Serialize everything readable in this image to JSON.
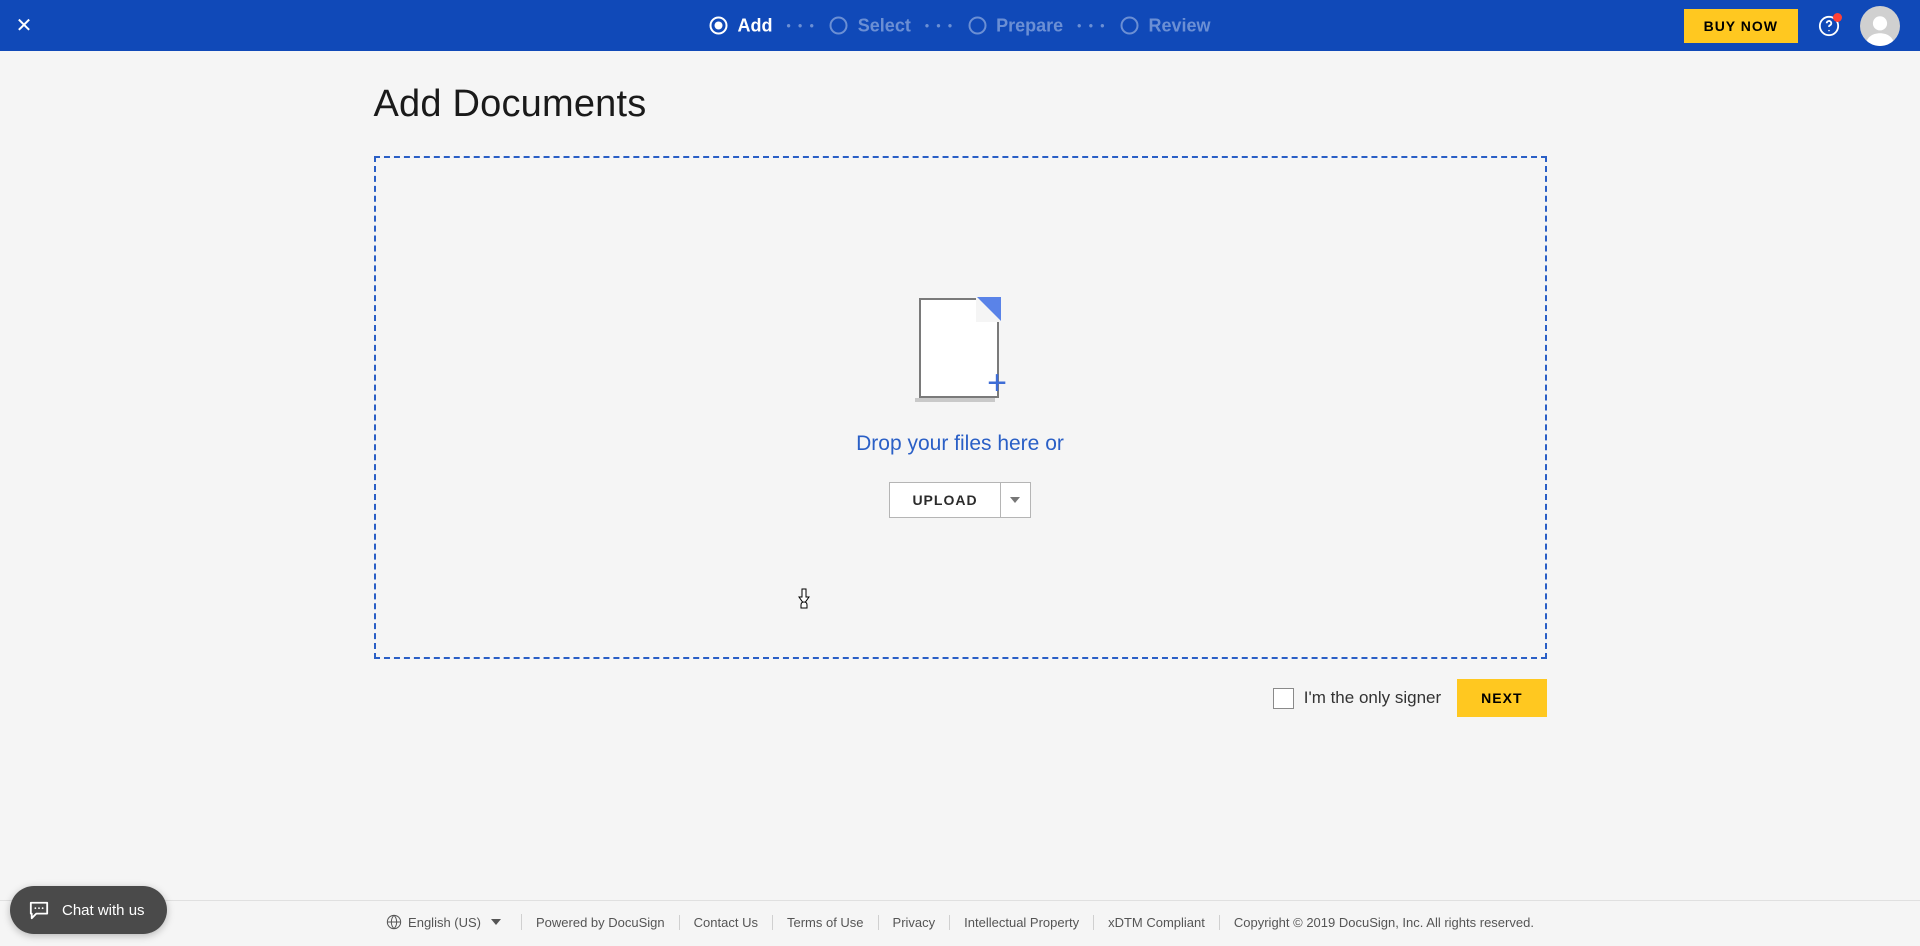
{
  "header": {
    "steps": [
      "Add",
      "Select",
      "Prepare",
      "Review"
    ],
    "active_step_index": 0,
    "buy_now": "BUY NOW"
  },
  "main": {
    "title": "Add Documents",
    "drop_text": "Drop your files here or",
    "upload_label": "UPLOAD"
  },
  "actions": {
    "only_signer_label": "I'm the only signer",
    "only_signer_checked": false,
    "next_label": "NEXT"
  },
  "footer": {
    "language": "English (US)",
    "links": [
      "Powered by DocuSign",
      "Contact Us",
      "Terms of Use",
      "Privacy",
      "Intellectual Property",
      "xDTM Compliant"
    ],
    "copyright": "Copyright © 2019 DocuSign, Inc. All rights reserved."
  },
  "chat": {
    "label": "Chat with us"
  }
}
